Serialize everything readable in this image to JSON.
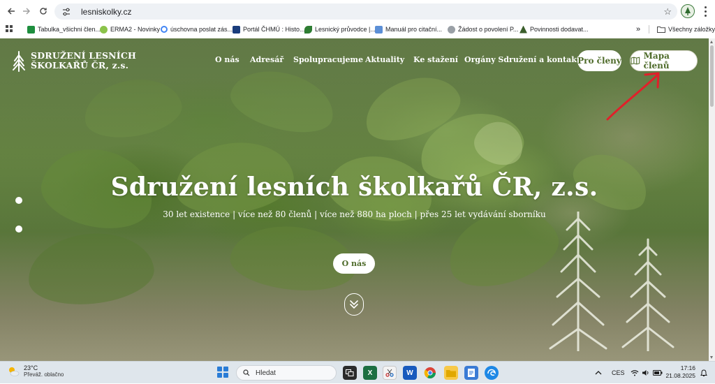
{
  "browser": {
    "url": "lesniskolky.cz",
    "bookmarks": [
      {
        "label": "Tabulka_všichni člen...",
        "color": "#1e8e3e"
      },
      {
        "label": "ERMA2 - Novinky",
        "color": "#8bc34a"
      },
      {
        "label": "úschovna poslat zás...",
        "color": "#4285f4"
      },
      {
        "label": "Portál ČHMÚ : Histo...",
        "color": "#1a3d7c"
      },
      {
        "label": "Lesnický průvodce |...",
        "color": "#2e7d32"
      },
      {
        "label": "Manuál pro citační...",
        "color": "#5c8fd6"
      },
      {
        "label": "Žádost o povolení P...",
        "color": "#9aa0a6"
      },
      {
        "label": "Povinnosti dodavat...",
        "color": "#3b5e2b"
      }
    ],
    "more_bookmarks_label": "»",
    "all_bookmarks_label": "Všechny záložky"
  },
  "site": {
    "brand_line1": "SDRUŽENÍ LESNÍCH",
    "brand_line2": "ŠKOLKAŘŮ ČR, z.s.",
    "nav": [
      "O nás",
      "Adresář",
      "Spolupracujeme",
      "Aktuality",
      "Ke stažení",
      "Orgány Sdružení a kontakty"
    ],
    "members_button": "Pro členy",
    "map_button": "Mapa členů",
    "hero_title": "Sdružení lesních školkařů ČR, z.s.",
    "hero_subtitle": "30 let existence | více než 80 členů | více než 880 ha ploch | přes 25 let vydávání sborníku",
    "hero_button": "O nás",
    "accent_color": "#4e6b2a",
    "annotation_arrow_color": "#e0202a"
  },
  "taskbar": {
    "temperature": "23°C",
    "weather": "Převáž. oblačno",
    "search_placeholder": "Hledat",
    "language": "CES",
    "time": "17:16",
    "date": "21.08.2025"
  }
}
